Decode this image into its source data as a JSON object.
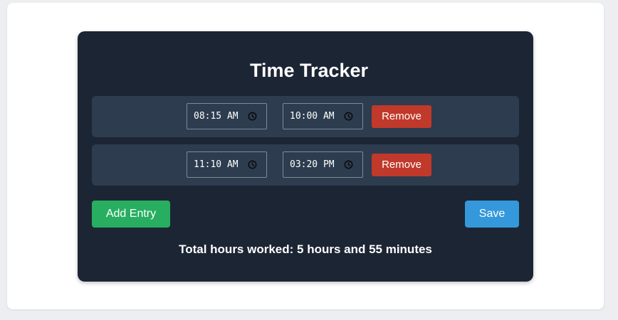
{
  "app": {
    "title": "Time Tracker"
  },
  "entries": [
    {
      "start": "08:15 AM",
      "end": "10:00 AM",
      "remove_label": "Remove"
    },
    {
      "start": "11:10 AM",
      "end": "03:20 PM",
      "remove_label": "Remove"
    }
  ],
  "actions": {
    "add_label": "Add Entry",
    "save_label": "Save"
  },
  "summary": {
    "total_text": "Total hours worked: 5 hours and 55 minutes"
  },
  "icons": {
    "time_picker": "clock-icon"
  },
  "colors": {
    "panel_bg": "#1c2533",
    "row_bg": "#2d3c4f",
    "remove": "#c0392b",
    "add": "#27ae60",
    "save": "#3498db"
  }
}
